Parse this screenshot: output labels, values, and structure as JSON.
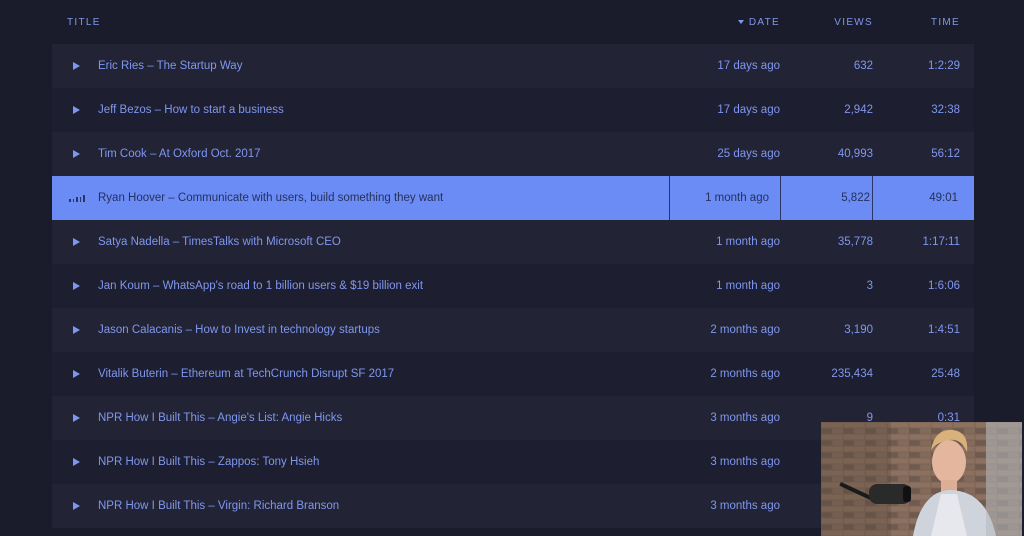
{
  "header": {
    "title": "TITLE",
    "date": "DATE",
    "views": "VIEWS",
    "time": "TIME"
  },
  "rows": [
    {
      "title": "Eric Ries – The Startup Way",
      "date": "17 days ago",
      "views": "632",
      "time": "1:2:29"
    },
    {
      "title": "Jeff Bezos – How to start a business",
      "date": "17 days ago",
      "views": "2,942",
      "time": "32:38"
    },
    {
      "title": "Tim Cook – At Oxford Oct. 2017",
      "date": "25 days ago",
      "views": "40,993",
      "time": "56:12"
    },
    {
      "title": "Ryan Hoover – Communicate with users, build something they want",
      "date": "1 month ago",
      "views": "5,822",
      "time": "49:01",
      "active": true
    },
    {
      "title": "Satya Nadella – TimesTalks with Microsoft CEO",
      "date": "1 month ago",
      "views": "35,778",
      "time": "1:17:11"
    },
    {
      "title": "Jan Koum – WhatsApp's road to 1 billion users & $19 billion exit",
      "date": "1 month ago",
      "views": "3",
      "time": "1:6:06"
    },
    {
      "title": "Jason Calacanis – How to Invest in technology startups",
      "date": "2 months ago",
      "views": "3,190",
      "time": "1:4:51"
    },
    {
      "title": "Vitalik Buterin – Ethereum at TechCrunch Disrupt SF 2017",
      "date": "2 months ago",
      "views": "235,434",
      "time": "25:48"
    },
    {
      "title": "NPR How I Built This – Angie's List: Angie Hicks",
      "date": "3 months ago",
      "views": "9",
      "time": "0:31"
    },
    {
      "title": "NPR How I Built This – Zappos: Tony Hsieh",
      "date": "3 months ago",
      "views": "",
      "time": ""
    },
    {
      "title": "NPR How I Built This – Virgin: Richard Branson",
      "date": "3 months ago",
      "views": "",
      "time": ""
    }
  ],
  "icons": {
    "play": "play-icon",
    "now_playing": "equalizer-icon",
    "sort": "sort-descending-icon"
  },
  "colors": {
    "background": "#1b1c2b",
    "accent": "#7f97ef",
    "active_row": "#6a8cf4"
  }
}
